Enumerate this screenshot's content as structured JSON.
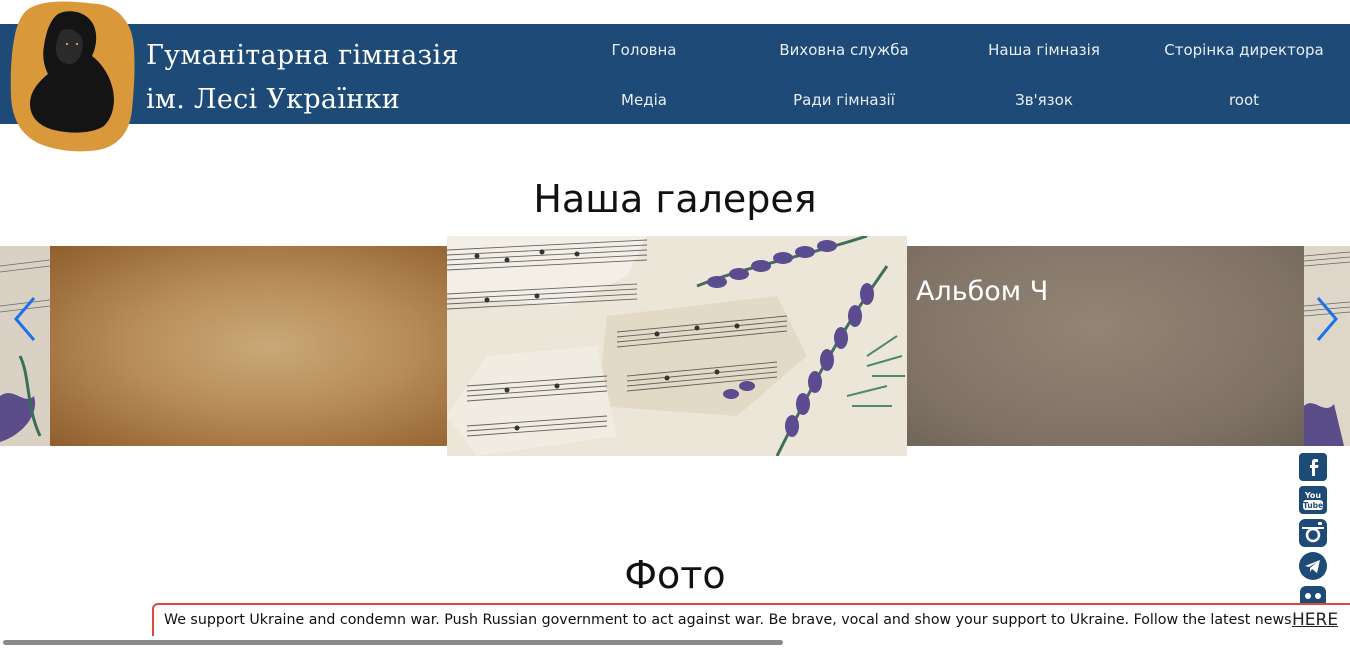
{
  "site": {
    "title_line1": "Гуманітарна гімназія",
    "title_line2": "ім. Лесі Українки"
  },
  "nav": {
    "items": [
      {
        "label": "Головна"
      },
      {
        "label": "Виховна служба"
      },
      {
        "label": "Наша гімназія"
      },
      {
        "label": "Сторінка директора"
      },
      {
        "label": "Медіа"
      },
      {
        "label": "Ради гімназії"
      },
      {
        "label": "Зв'язок"
      },
      {
        "label": "root"
      }
    ]
  },
  "gallery": {
    "heading": "Наша галерея",
    "album_title": "Альбом Ч"
  },
  "photo": {
    "heading": "Фото"
  },
  "social": [
    "facebook-icon",
    "youtube-icon",
    "instagram-icon",
    "telegram-icon",
    "viber-icon"
  ],
  "banner": {
    "text": "We support Ukraine and condemn war. Push Russian government to act against war. Be brave, vocal and show your support to Ukraine. Follow the latest news",
    "link": "HERE"
  },
  "colors": {
    "header_bg": "#1d4a76",
    "arrow": "#1a73e8",
    "banner_border": "#e0473d"
  }
}
